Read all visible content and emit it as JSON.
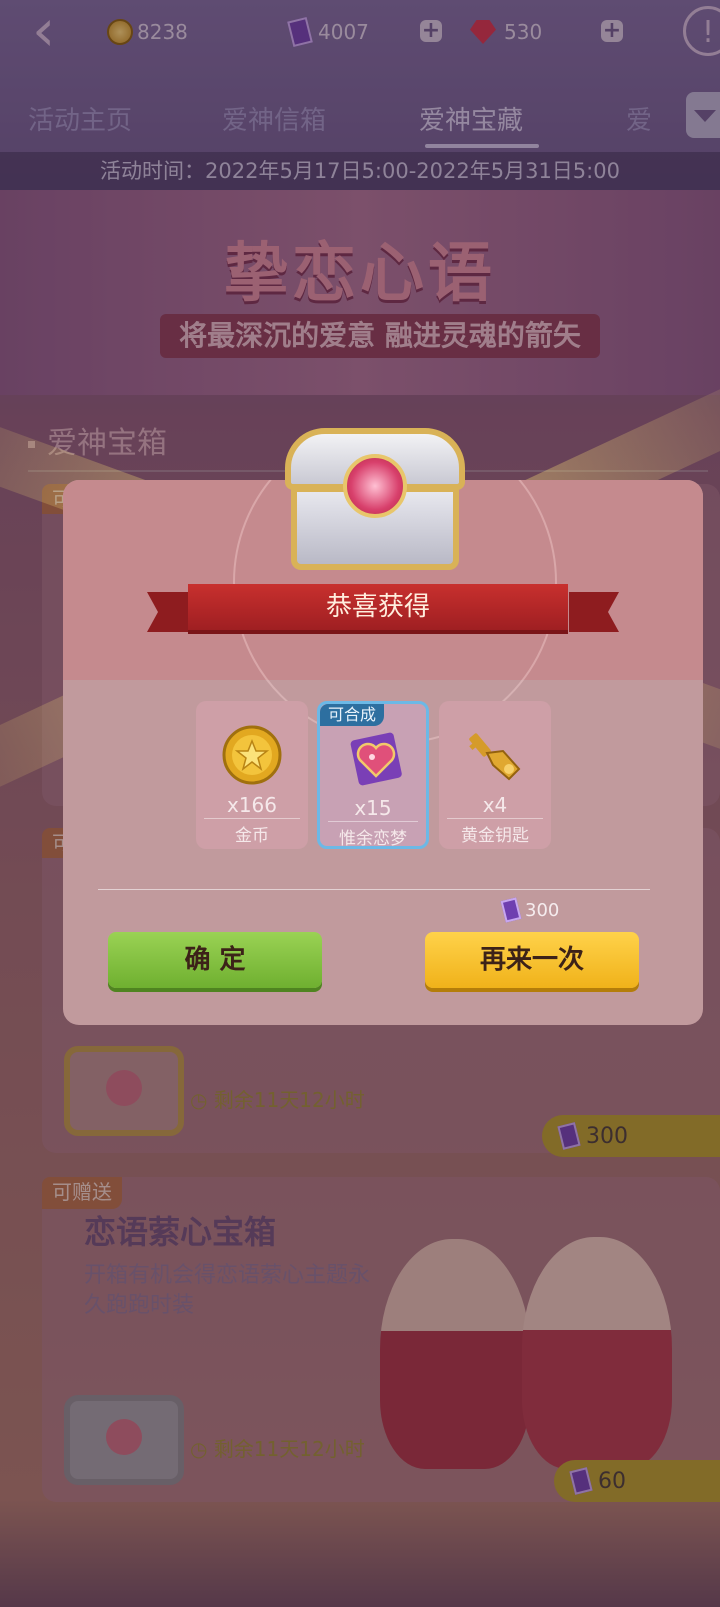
{
  "topbar": {
    "coins": "8238",
    "tickets": "4007",
    "gems": "530"
  },
  "tabs": [
    "活动主页",
    "爱神信箱",
    "爱神宝藏",
    "爱"
  ],
  "event_time": "活动时间：2022年5月17日5:00-2022年5月31日5:00",
  "banner": {
    "title": "挚恋心语",
    "subtitle": "将最深沉的爱意 融进灵魂的箭矢"
  },
  "section_title": "爱神宝箱",
  "cards": [
    {
      "tag": "可",
      "remaining": "剩余11天12小时",
      "price": "300"
    },
    {
      "tag": "可赠送",
      "title": "恋语萦心宝箱",
      "desc": "开箱有机会得恋语萦心主题永久跑跑时装",
      "remaining": "剩余11天12小时",
      "price": "60"
    }
  ],
  "dialog": {
    "title": "恭喜获得",
    "items": [
      {
        "count": "x166",
        "name": "金币",
        "icon": "gold-coin-icon"
      },
      {
        "count": "x15",
        "name": "惟余恋梦",
        "icon": "heart-gem-card-icon",
        "badge": "可合成"
      },
      {
        "count": "x4",
        "name": "黄金钥匙",
        "icon": "golden-key-icon"
      }
    ],
    "cost": "300",
    "confirm_label": "确 定",
    "again_label": "再来一次"
  },
  "colors": {
    "confirm_green": "#7fbf3a",
    "again_yellow": "#f6c22c",
    "ribbon_red": "#b5272a",
    "highlight_blue": "#6cb8e6"
  }
}
